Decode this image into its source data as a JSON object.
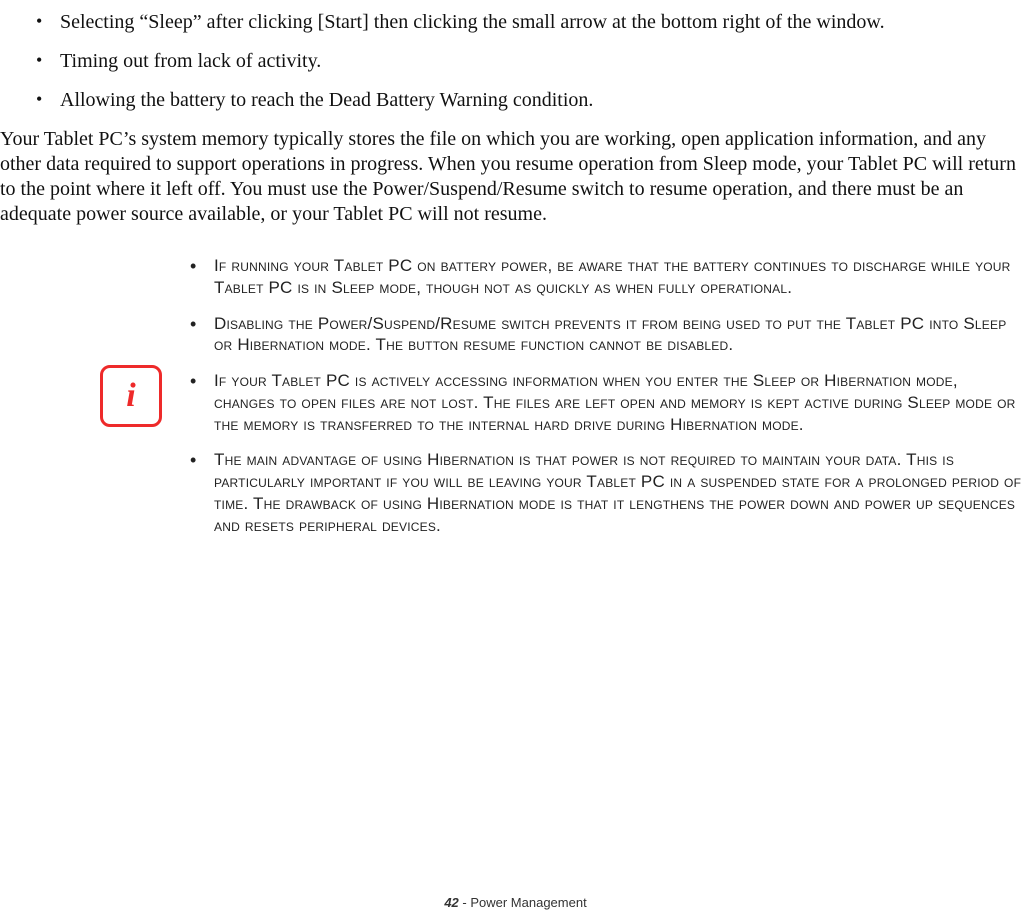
{
  "top_bullets": [
    "Selecting “Sleep” after clicking [Start] then clicking the small arrow at the bottom right of the window.",
    "Timing out from lack of activity.",
    "Allowing the battery to reach the Dead Battery Warning condition."
  ],
  "paragraph": "Your Tablet PC’s system memory typically stores the file on which you are working, open application information, and any other data required to support operations in progress. When you resume operation from Sleep mode, your Tablet PC will return to the point where it left off. You must use the Power/Suspend/Resume switch to resume operation, and there must be an adequate power source available, or your Tablet PC will not resume.",
  "info_icon_glyph": "i",
  "note_bullets": [
    "If running your Tablet PC on battery power, be aware that the battery continues to discharge while your Tablet PC is in Sleep mode, though not as quickly as when fully operational.",
    "Disabling the Power/Suspend/Resume switch prevents it from being used to put the Tablet PC into Sleep or Hibernation mode. The button resume function cannot be disabled.",
    "If your Tablet PC is actively accessing information when you enter the Sleep or Hibernation mode, changes to open files are not lost. The files are left open and memory is kept active during Sleep mode or the memory is transferred to the internal hard drive during Hibernation mode.",
    "The main advantage of using Hibernation is that power is not required to maintain your data. This is particularly important if you will be leaving your Tablet PC in a suspended state for a prolonged period of time. The drawback of using Hibernation mode is that it lengthens the power down and power up sequences and resets peripheral devices."
  ],
  "footer": {
    "page_number": "42",
    "separator": " - ",
    "section": "Power Management"
  }
}
